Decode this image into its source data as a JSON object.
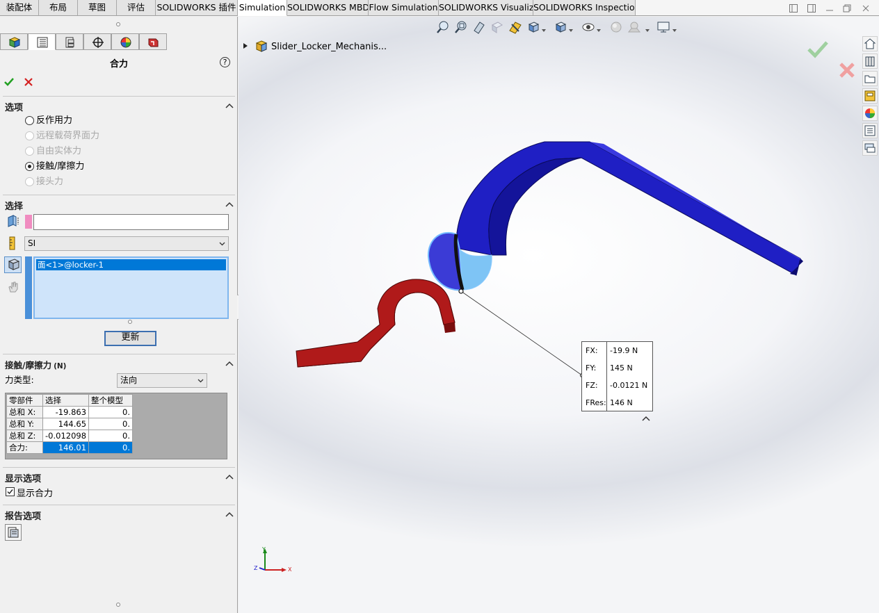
{
  "tabs": [
    "装配体",
    "布局",
    "草图",
    "评估",
    "SOLIDWORKS 插件",
    "Simulation",
    "SOLIDWORKS MBD",
    "Flow Simulation",
    "SOLIDWORKS Visualize",
    "SOLIDWORKS Inspection"
  ],
  "active_tab": "Simulation",
  "panel": {
    "title": "合力",
    "help": "?",
    "sections": {
      "options": {
        "title": "选项",
        "items": [
          {
            "label": "反作用力",
            "checked": false,
            "enabled": true
          },
          {
            "label": "远程载荷界面力",
            "checked": false,
            "enabled": false
          },
          {
            "label": "自由实体力",
            "checked": false,
            "enabled": false
          },
          {
            "label": "接触/摩擦力",
            "checked": true,
            "enabled": true
          },
          {
            "label": "接头力",
            "checked": false,
            "enabled": false
          }
        ]
      },
      "selection": {
        "title": "选择",
        "units": "SI",
        "list_item": "面<1>@locker-1",
        "update_button": "更新"
      },
      "contact": {
        "title": "接触/摩擦力",
        "unit": "(N)",
        "force_type_label": "力类型:",
        "force_type_value": "法向",
        "table": {
          "headers": [
            "零部件",
            "选择",
            "整个模型"
          ],
          "rows": [
            {
              "label": "总和 X:",
              "sel": "-19.863",
              "whole": "0."
            },
            {
              "label": "总和 Y:",
              "sel": "144.65",
              "whole": "0."
            },
            {
              "label": "总和 Z:",
              "sel": "-0.012098",
              "whole": "0."
            },
            {
              "label": "合力:",
              "sel": "146.01",
              "whole": "0."
            }
          ]
        }
      },
      "display": {
        "title": "显示选项",
        "checkbox_label": "显示合力",
        "checked": true
      },
      "report": {
        "title": "报告选项"
      }
    }
  },
  "viewport": {
    "tree_root": "Slider_Locker_Mechanis...",
    "result": [
      {
        "key": "FX:",
        "value": "-19.9 N"
      },
      {
        "key": "FY:",
        "value": "145 N"
      },
      {
        "key": "FZ:",
        "value": "-0.0121 N"
      },
      {
        "key": "FRes:",
        "value": "146 N"
      }
    ],
    "triad": {
      "x": "X",
      "y": "Y",
      "z": "Z"
    }
  },
  "colors": {
    "blue_part": "#1414b8",
    "red_part": "#b21818",
    "selection": "#0078d7",
    "ok_green": "#22a022",
    "cancel_red": "#d42020"
  }
}
